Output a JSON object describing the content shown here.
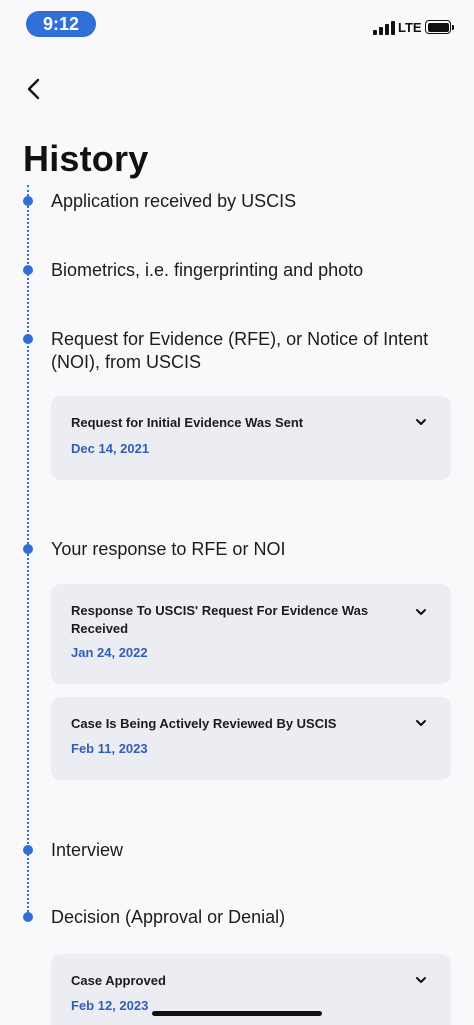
{
  "status_bar": {
    "time": "9:12",
    "network": "LTE",
    "icons": [
      "signal-icon",
      "battery-icon"
    ]
  },
  "nav": {
    "back_icon": "chevron-left-icon"
  },
  "page_title": "History",
  "colors": {
    "accent": "#2f6fd6",
    "date": "#2f5fb8",
    "card_bg": "#ecedf2",
    "page_bg": "#f9f9fb"
  },
  "steps": [
    {
      "label": "Application received by USCIS"
    },
    {
      "label": "Biometrics, i.e. fingerprinting and photo"
    },
    {
      "label": "Request for Evidence (RFE), or Notice of Intent (NOI), from USCIS"
    },
    {
      "label": "Your response to RFE or NOI"
    },
    {
      "label": "Interview"
    },
    {
      "label": "Decision (Approval or Denial)"
    }
  ],
  "events": [
    {
      "title": "Request for Initial Evidence Was Sent",
      "date": "Dec 14, 2021"
    },
    {
      "title": "Response To USCIS' Request For Evidence Was Received",
      "date": "Jan 24, 2022"
    },
    {
      "title": "Case Is Being Actively Reviewed By USCIS",
      "date": "Feb 11, 2023"
    },
    {
      "title": "Case Approved",
      "date": "Feb 12, 2023"
    }
  ]
}
